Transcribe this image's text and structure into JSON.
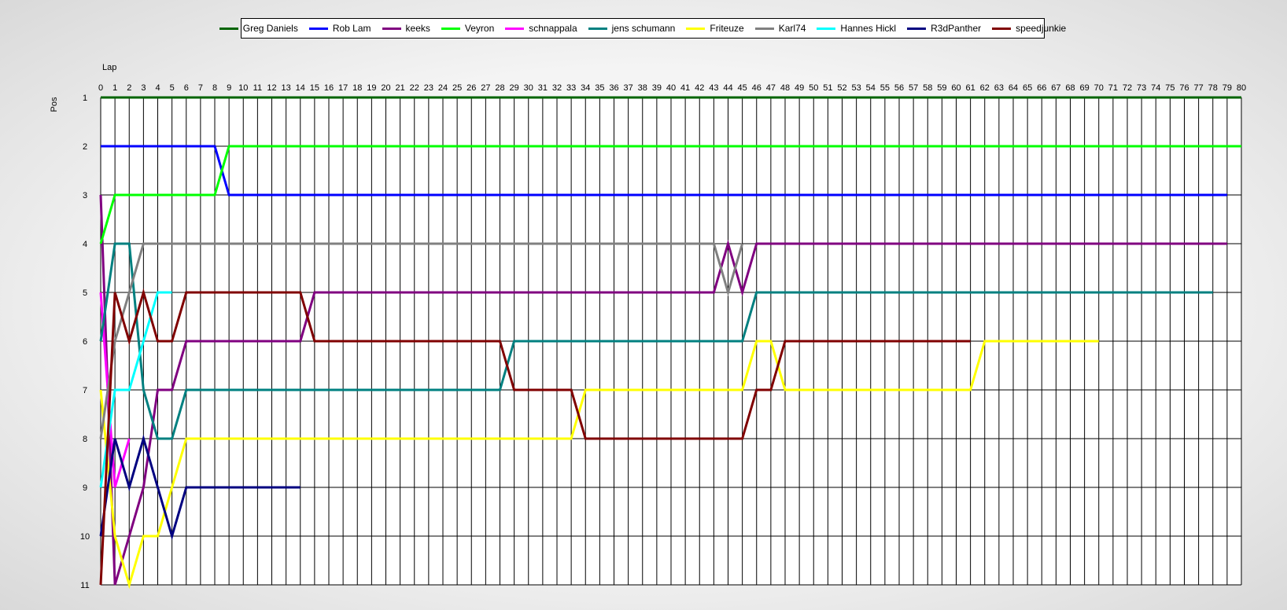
{
  "chart_data": {
    "type": "line",
    "xlabel": "Lap",
    "ylabel": "Pos",
    "xlim": [
      0,
      80
    ],
    "ylim": [
      1,
      11
    ],
    "y_inverted": true,
    "grid": true,
    "legend_position": "top",
    "x_ticks": [
      0,
      1,
      2,
      3,
      4,
      5,
      6,
      7,
      8,
      9,
      10,
      11,
      12,
      13,
      14,
      15,
      16,
      17,
      18,
      19,
      20,
      21,
      22,
      23,
      24,
      25,
      26,
      27,
      28,
      29,
      30,
      31,
      32,
      33,
      34,
      35,
      36,
      37,
      38,
      39,
      40,
      41,
      42,
      43,
      44,
      45,
      46,
      47,
      48,
      49,
      50,
      51,
      52,
      53,
      54,
      55,
      56,
      57,
      58,
      59,
      60,
      61,
      62,
      63,
      64,
      65,
      66,
      67,
      68,
      69,
      70,
      71,
      72,
      73,
      74,
      75,
      76,
      77,
      78,
      79,
      80
    ],
    "y_ticks": [
      1,
      2,
      3,
      4,
      5,
      6,
      7,
      8,
      9,
      10,
      11
    ],
    "series": [
      {
        "name": "Greg Daniels",
        "color": "#006400",
        "x": [
          0,
          80
        ],
        "y": [
          1,
          1
        ]
      },
      {
        "name": "Rob Lam",
        "color": "#0000ff",
        "x": [
          0,
          8,
          9,
          79
        ],
        "y": [
          2,
          2,
          3,
          3
        ]
      },
      {
        "name": "keeks",
        "color": "#800080",
        "x": [
          0,
          1,
          2,
          3,
          4,
          5,
          6,
          14,
          15,
          43,
          44,
          45,
          46,
          79
        ],
        "y": [
          3,
          11,
          10,
          9,
          7,
          7,
          6,
          6,
          5,
          5,
          4,
          5,
          4,
          4
        ]
      },
      {
        "name": "Veyron",
        "color": "#00ff00",
        "x": [
          0,
          1,
          8,
          9,
          80
        ],
        "y": [
          4,
          3,
          3,
          2,
          2
        ]
      },
      {
        "name": "schnappala",
        "color": "#ff00ff",
        "x": [
          0,
          1,
          2
        ],
        "y": [
          5,
          9,
          8
        ]
      },
      {
        "name": "jens  schumann",
        "color": "#008080",
        "x": [
          0,
          1,
          2,
          3,
          4,
          5,
          6,
          28,
          29,
          45,
          46,
          78
        ],
        "y": [
          6,
          4,
          4,
          7,
          8,
          8,
          7,
          7,
          6,
          6,
          5,
          5
        ]
      },
      {
        "name": "Friteuze",
        "color": "#ffff00",
        "x": [
          0,
          1,
          2,
          3,
          4,
          5,
          6,
          33,
          34,
          45,
          46,
          47,
          48,
          61,
          62,
          70
        ],
        "y": [
          7,
          10,
          11,
          10,
          10,
          9,
          8,
          8,
          7,
          7,
          6,
          6,
          7,
          7,
          6,
          6
        ]
      },
      {
        "name": "Karl74",
        "color": "#808080",
        "x": [
          0,
          1,
          2,
          3,
          43,
          44,
          45
        ],
        "y": [
          8,
          6,
          5,
          4,
          4,
          5,
          4
        ]
      },
      {
        "name": "Hannes Hickl",
        "color": "#00ffff",
        "x": [
          0,
          1,
          2,
          3,
          4,
          5
        ],
        "y": [
          9,
          7,
          7,
          6,
          5,
          5
        ]
      },
      {
        "name": "R3dPanther",
        "color": "#000080",
        "x": [
          0,
          1,
          2,
          3,
          4,
          5,
          6,
          14
        ],
        "y": [
          10,
          8,
          9,
          8,
          9,
          10,
          9,
          9
        ]
      },
      {
        "name": "speedjunkie",
        "color": "#800000",
        "x": [
          0,
          1,
          2,
          3,
          4,
          5,
          6,
          14,
          15,
          28,
          29,
          33,
          34,
          45,
          46,
          47,
          48,
          61
        ],
        "y": [
          11,
          5,
          6,
          5,
          6,
          6,
          5,
          5,
          6,
          6,
          7,
          7,
          8,
          8,
          7,
          7,
          6,
          6
        ]
      }
    ]
  }
}
